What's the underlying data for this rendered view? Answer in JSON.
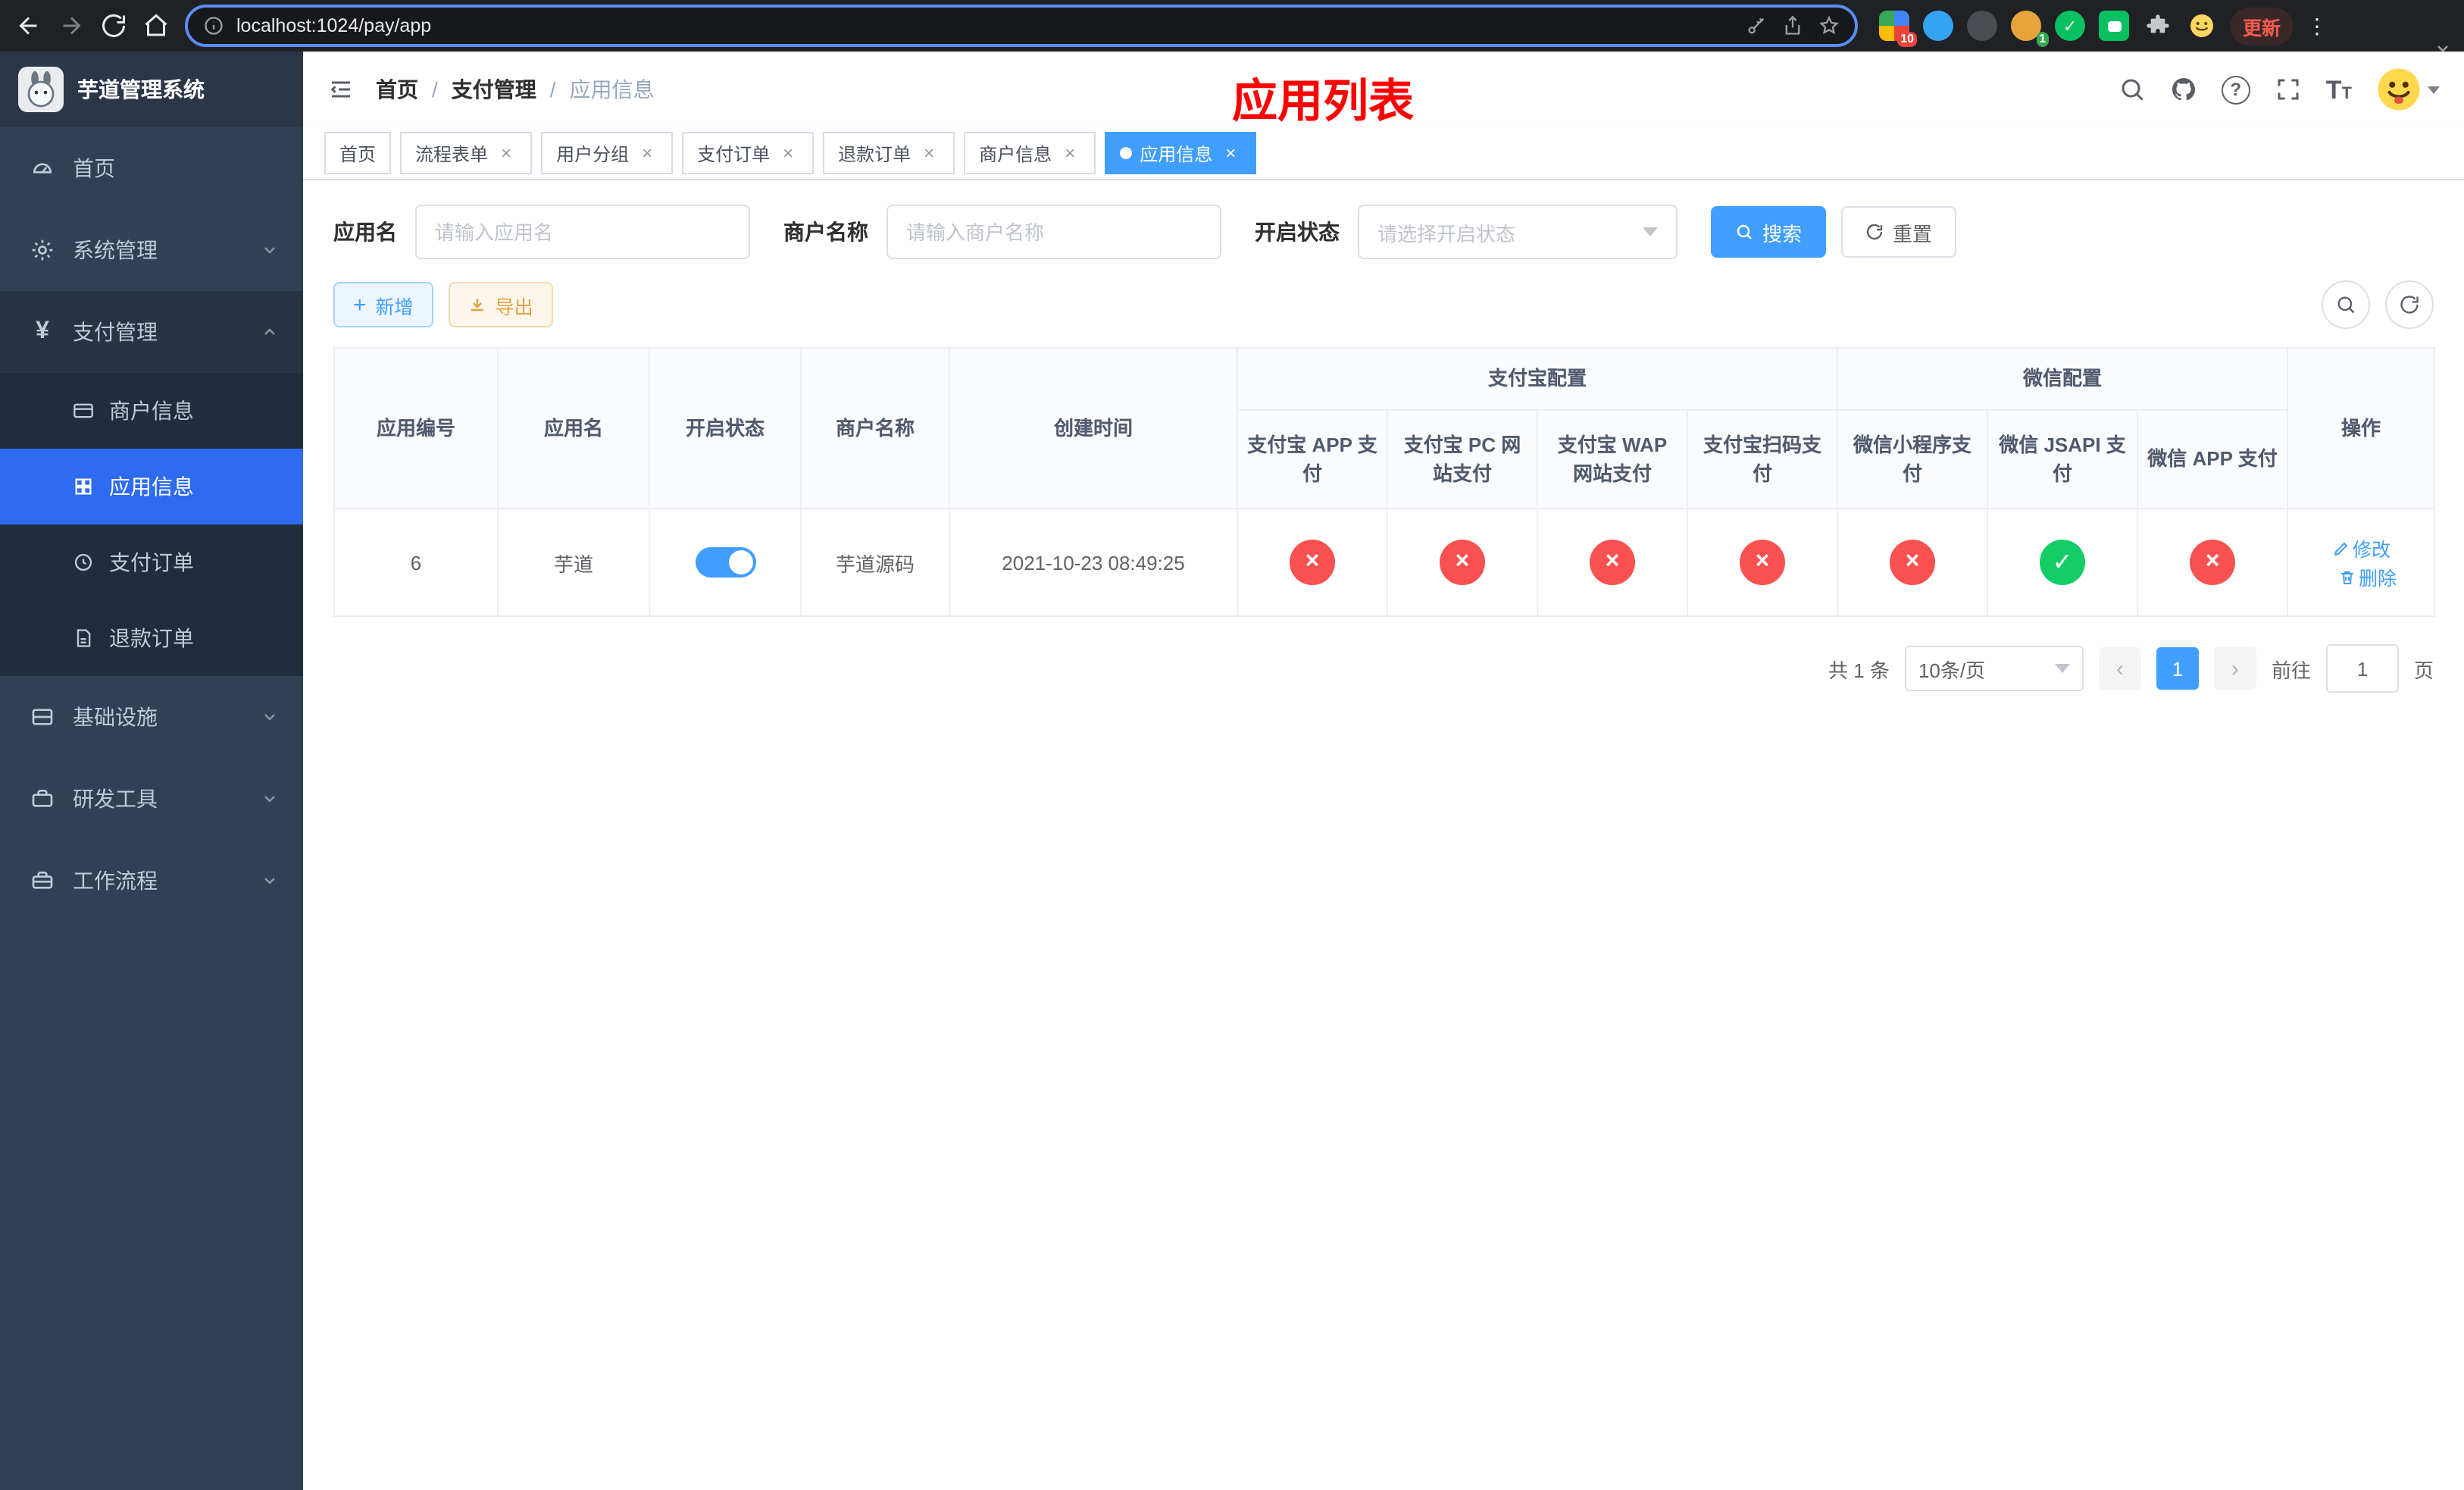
{
  "browser": {
    "url": "localhost:1024/pay/app",
    "update_label": "更新",
    "ext_badge_count": "10",
    "profile_badge_count": "1"
  },
  "sidebar": {
    "title": "芋道管理系统",
    "menu": [
      {
        "label": "首页"
      },
      {
        "label": "系统管理"
      },
      {
        "label": "支付管理"
      },
      {
        "label": "基础设施"
      },
      {
        "label": "研发工具"
      },
      {
        "label": "工作流程"
      }
    ],
    "submenu": [
      {
        "label": "商户信息"
      },
      {
        "label": "应用信息"
      },
      {
        "label": "支付订单"
      },
      {
        "label": "退款订单"
      }
    ]
  },
  "navbar": {
    "breadcrumb": [
      "首页",
      "支付管理",
      "应用信息"
    ],
    "annotation": "应用列表"
  },
  "tabs": [
    {
      "label": "首页"
    },
    {
      "label": "流程表单"
    },
    {
      "label": "用户分组"
    },
    {
      "label": "支付订单"
    },
    {
      "label": "退款订单"
    },
    {
      "label": "商户信息"
    },
    {
      "label": "应用信息"
    }
  ],
  "filters": {
    "app_name": {
      "label": "应用名",
      "placeholder": "请输入应用名",
      "value": ""
    },
    "merchant_name": {
      "label": "商户名称",
      "placeholder": "请输入商户名称",
      "value": ""
    },
    "status": {
      "label": "开启状态",
      "placeholder": "请选择开启状态"
    },
    "search_label": "搜索",
    "reset_label": "重置"
  },
  "toolbar": {
    "add_label": "新增",
    "export_label": "导出"
  },
  "table": {
    "group_headers": {
      "alipay": "支付宝配置",
      "wechat": "微信配置"
    },
    "plain_headers": {
      "id": "应用编号",
      "name": "应用名",
      "status": "开启状态",
      "merchant": "商户名称",
      "created": "创建时间",
      "actions": "操作"
    },
    "sub_headers": [
      "支付宝 APP 支付",
      "支付宝 PC 网站支付",
      "支付宝 WAP 网站支付",
      "支付宝扫码支付",
      "微信小程序支付",
      "微信 JSAPI 支付",
      "微信 APP 支付"
    ],
    "row": {
      "id": "6",
      "name": "芋道",
      "enabled": true,
      "merchant": "芋道源码",
      "created": "2021-10-23 08:49:25",
      "pay_statuses": [
        "no",
        "no",
        "no",
        "no",
        "no",
        "yes",
        "no"
      ],
      "edit_label": "修改",
      "delete_label": "删除"
    }
  },
  "pagination": {
    "total": "共 1 条",
    "page_size": "10条/页",
    "page": "1",
    "goto_prefix": "前往",
    "goto_value": "1",
    "goto_suffix": "页"
  },
  "colors": {
    "primary": "#409eff",
    "sidebar_active": "#2d6bf0",
    "danger": "#f8514f",
    "success": "#13ce66",
    "warning": "#e6a23c",
    "annotation_red": "#ff0000"
  }
}
